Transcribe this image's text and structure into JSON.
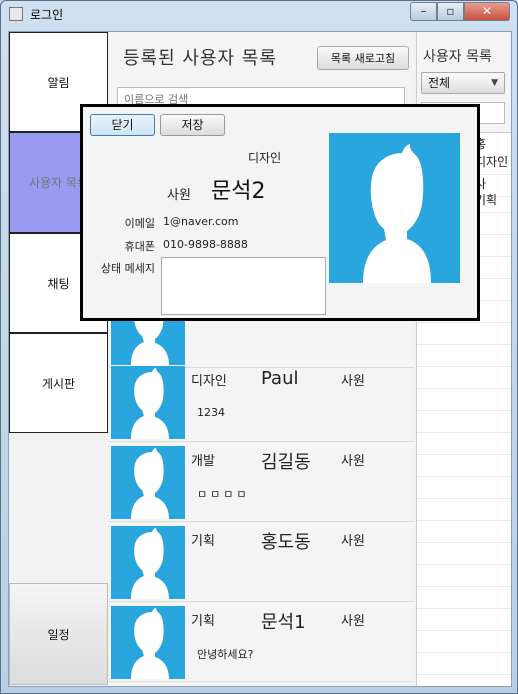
{
  "window": {
    "title": "로그인",
    "minimize_glyph": "–",
    "maximize_glyph": "▫",
    "close_glyph": "✕"
  },
  "nav": {
    "items": [
      {
        "label": "알림"
      },
      {
        "label": "사용자 목록"
      },
      {
        "label": "채팅"
      },
      {
        "label": "게시판"
      },
      {
        "label": "일정"
      }
    ]
  },
  "main": {
    "title": "등록된 사용자 목록",
    "refresh_label": "목록 새로고침",
    "search_placeholder": "이름으로 검색",
    "cards": [
      {
        "dept": "",
        "name": "",
        "position": "",
        "message": ""
      },
      {
        "dept": "디자인",
        "name": "Paul",
        "position": "사원",
        "message": "1234"
      },
      {
        "dept": "개발",
        "name": "김길동",
        "position": "사원",
        "message": "ㅁㅁㅁㅁ"
      },
      {
        "dept": "기획",
        "name": "홍도동",
        "position": "사원",
        "message": ""
      },
      {
        "dept": "기획",
        "name": "문석1",
        "position": "사원",
        "message": "안녕하세요?"
      }
    ]
  },
  "right_panel": {
    "title": "사용자 목록",
    "filter_value": "전체",
    "rows": [
      "홍",
      "디자인",
      "사",
      "기획"
    ]
  },
  "popup": {
    "close_label": "닫기",
    "save_label": "저장",
    "dept": "디자인",
    "position": "사원",
    "name": "문석2",
    "email_label": "이메일",
    "email_value": "1@naver.com",
    "phone_label": "휴대폰",
    "phone_value": "010-9898-8888",
    "status_label": "상태 메세지",
    "status_value": ""
  },
  "colors": {
    "avatar_bg": "#2aa6df",
    "nav_active": "#9a9af2"
  }
}
